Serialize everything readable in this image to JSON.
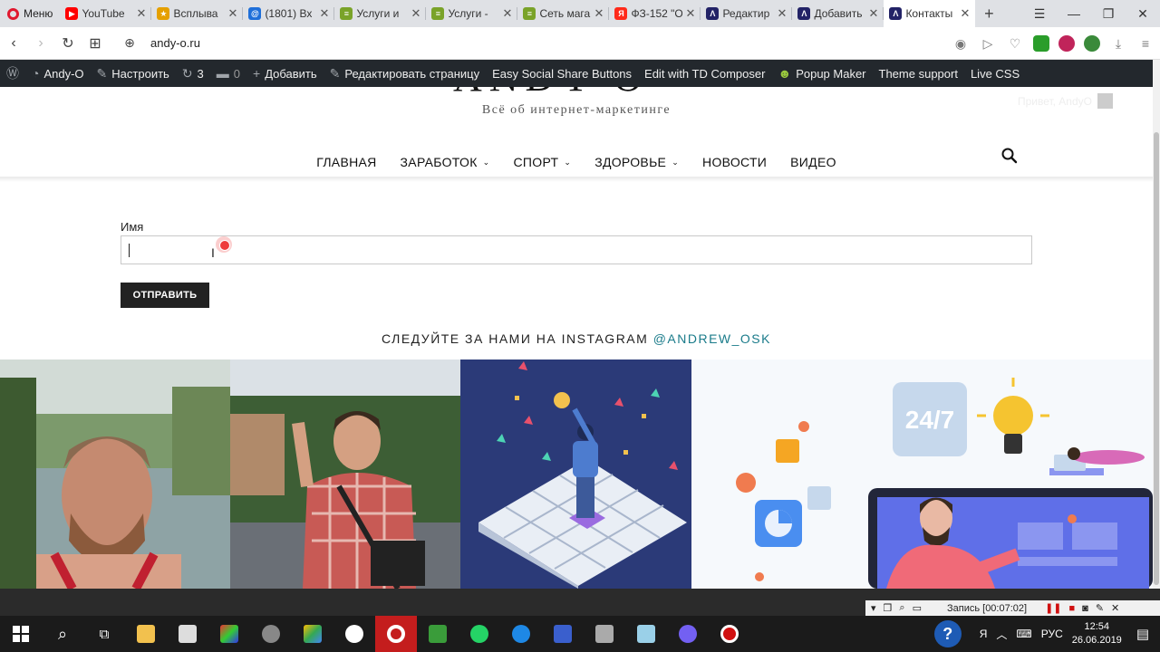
{
  "browser": {
    "menu_label": "Меню",
    "tabs": [
      {
        "title": "YouTube",
        "color": "#ff0000",
        "glyph": "▶"
      },
      {
        "title": "Всплыва",
        "color": "#e5a000",
        "glyph": "★"
      },
      {
        "title": "(1801) Вх",
        "color": "#1e6fd9",
        "glyph": "@"
      },
      {
        "title": "Услуги и",
        "color": "#7aa329",
        "glyph": "≡"
      },
      {
        "title": "Услуги - ",
        "color": "#7aa329",
        "glyph": "≡"
      },
      {
        "title": "Сеть мага",
        "color": "#7aa329",
        "glyph": "≡"
      },
      {
        "title": "ФЗ-152 \"О",
        "color": "#ff2a1a",
        "glyph": "Я"
      },
      {
        "title": "Редактир",
        "color": "#222266",
        "glyph": "Λ"
      },
      {
        "title": "Добавить",
        "color": "#222266",
        "glyph": "Λ"
      },
      {
        "title": "Контакты",
        "color": "#222266",
        "glyph": "Λ",
        "active": true
      }
    ],
    "url": "andy-o.ru"
  },
  "adminbar": {
    "site_name": "Andy-O",
    "customize": "Настроить",
    "updates": "3",
    "comments": "0",
    "add_new": "Добавить",
    "edit_page": "Редактировать страницу",
    "plugin1": "Easy Social Share Buttons",
    "plugin2": "Edit with TD Composer",
    "plugin3": "Popup Maker",
    "plugin4": "Theme support",
    "plugin5": "Live CSS"
  },
  "site": {
    "tagline": "Всё об интернет-маркетинге",
    "greeting": "Привет, AndyO",
    "menu": [
      {
        "label": "ГЛАВНАЯ",
        "dropdown": false
      },
      {
        "label": "ЗАРАБОТОК",
        "dropdown": true
      },
      {
        "label": "СПОРТ",
        "dropdown": true
      },
      {
        "label": "ЗДОРОВЬЕ",
        "dropdown": true
      },
      {
        "label": "НОВОСТИ",
        "dropdown": false
      },
      {
        "label": "ВИДЕО",
        "dropdown": false
      }
    ]
  },
  "form": {
    "name_label": "Имя",
    "name_value": "",
    "submit_label": "ОТПРАВИТЬ"
  },
  "instagram": {
    "heading": "СЛЕДУЙТЕ ЗА НАМИ НА INSTAGRAM ",
    "handle": "@ANDREW_OSK",
    "badge_247": "24/7"
  },
  "recorder": {
    "status": "Запись [00:07:02]"
  },
  "taskbar": {
    "language": "РУС",
    "time": "12:54",
    "date": "26.06.2019"
  }
}
